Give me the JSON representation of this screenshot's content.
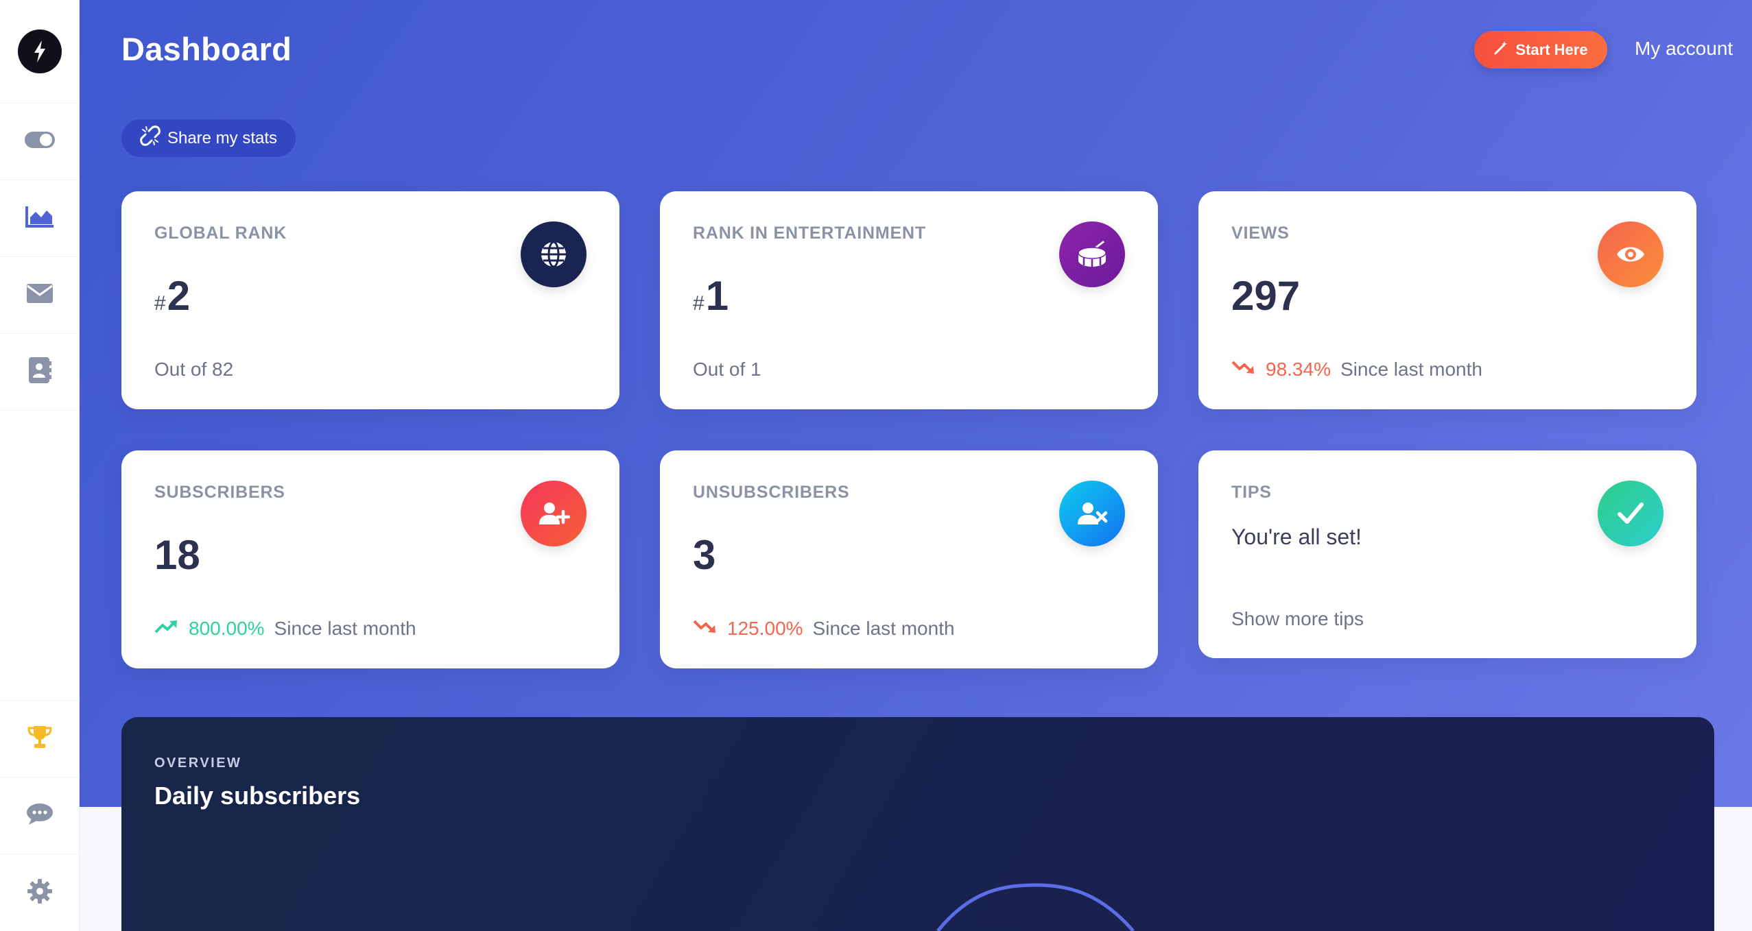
{
  "sidebar": {
    "logo_icon": "lightning-bolt-icon",
    "top_items": [
      {
        "name": "toggle",
        "icon": "toggle-icon",
        "active": false
      },
      {
        "name": "stats",
        "icon": "area-chart-icon",
        "active": true
      },
      {
        "name": "mail",
        "icon": "envelope-icon",
        "active": false
      },
      {
        "name": "contacts",
        "icon": "contact-book-icon",
        "active": false
      }
    ],
    "bottom_items": [
      {
        "name": "trophy",
        "icon": "trophy-icon"
      },
      {
        "name": "chat",
        "icon": "chat-icon"
      },
      {
        "name": "settings",
        "icon": "gear-icon"
      }
    ]
  },
  "header": {
    "title": "Dashboard",
    "start_label": "Start Here",
    "account_label": "My account",
    "share_label": "Share my stats"
  },
  "cards": {
    "global_rank": {
      "label": "GLOBAL RANK",
      "hash": "#",
      "value": "2",
      "sub": "Out of 82",
      "icon": "globe-icon",
      "color": "#1a2450"
    },
    "rank_entertainment": {
      "label": "RANK IN ENTERTAINMENT",
      "hash": "#",
      "value": "1",
      "sub": "Out of 1",
      "icon": "drum-icon",
      "color": "#7b1fa2"
    },
    "views": {
      "label": "VIEWS",
      "value": "297",
      "pct": "98.34%",
      "trend": "down",
      "since": "Since last month",
      "icon": "eye-icon",
      "color": "#fb7a3a"
    },
    "subscribers": {
      "label": "SUBSCRIBERS",
      "value": "18",
      "pct": "800.00%",
      "trend": "up",
      "since": "Since last month",
      "icon": "user-plus-icon",
      "color": "#f5365c"
    },
    "unsubscribers": {
      "label": "UNSUBSCRIBERS",
      "value": "3",
      "pct": "125.00%",
      "trend": "down",
      "since": "Since last month",
      "icon": "user-remove-icon",
      "color": "#1aa0e8"
    },
    "tips": {
      "label": "TIPS",
      "text": "You're all set!",
      "link": "Show more tips",
      "icon": "check-icon",
      "color": "#2dce89"
    }
  },
  "overview": {
    "kicker": "OVERVIEW",
    "title": "Daily subscribers"
  },
  "colors": {
    "hero": "#4a5fd4",
    "accent_orange": "#f5503f",
    "up": "#2fd1a2",
    "down": "#f5654d"
  }
}
